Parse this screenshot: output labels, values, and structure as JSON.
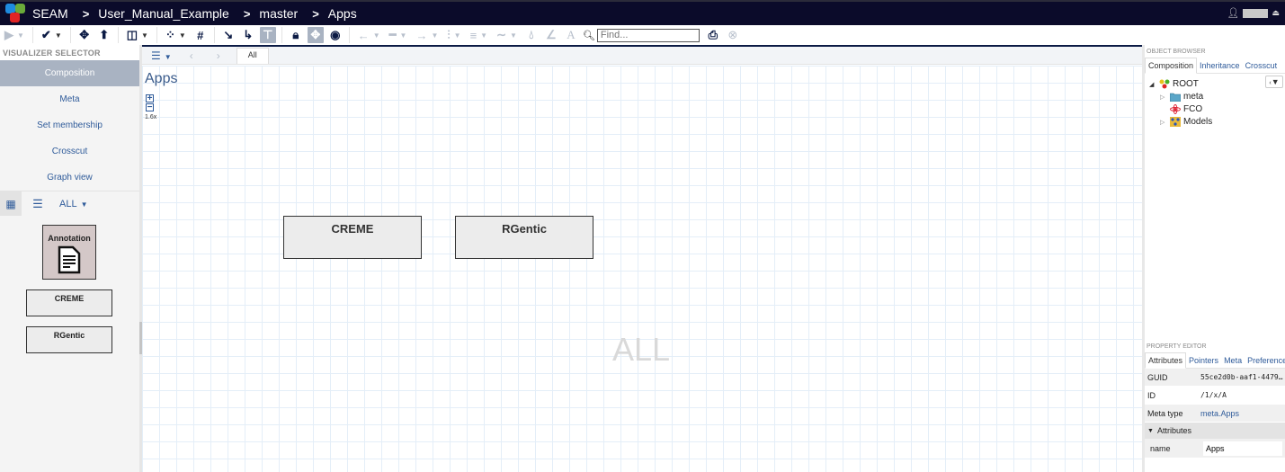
{
  "topbar": {
    "app_name": "SEAM",
    "breadcrumbs": [
      "User_Manual_Example",
      "master",
      "Apps"
    ],
    "separator": ">",
    "user_icon": "user-icon",
    "menu_icon": "eject-icon"
  },
  "toolbar": {
    "buttons": [
      {
        "name": "play-button",
        "glyph": "▶",
        "caret": true,
        "disabled": true
      },
      {
        "name": "check-button",
        "glyph": "✔",
        "caret": true
      },
      {
        "name": "move-button",
        "glyph": "✥"
      },
      {
        "name": "arrow-up-button",
        "glyph": "⬆"
      },
      {
        "name": "columns-button",
        "glyph": "◫",
        "caret": true
      },
      {
        "name": "grid-button",
        "glyph": "⁘",
        "caret": true
      },
      {
        "name": "hash-button",
        "glyph": "#"
      },
      {
        "name": "connect-button",
        "glyph": "↘"
      },
      {
        "name": "elbow-connect-button",
        "glyph": "↳"
      },
      {
        "name": "tree-button",
        "glyph": "⊤",
        "active": true
      },
      {
        "name": "lock-button",
        "glyph": "🔒︎"
      },
      {
        "name": "pan-button",
        "glyph": "✥",
        "active": true
      },
      {
        "name": "eye-button",
        "glyph": "◉"
      },
      {
        "name": "arrow-start-button",
        "glyph": "←",
        "caret": true,
        "disabled": true
      },
      {
        "name": "line-pattern-button",
        "glyph": "━",
        "caret": true,
        "disabled": true
      },
      {
        "name": "arrow-end-button",
        "glyph": "→",
        "caret": true,
        "disabled": true
      },
      {
        "name": "line-type-button",
        "glyph": "⫶",
        "caret": true,
        "disabled": true
      },
      {
        "name": "line-width-button",
        "glyph": "≡",
        "caret": true,
        "disabled": true
      },
      {
        "name": "line-style-button",
        "glyph": "∼",
        "caret": true,
        "disabled": true
      },
      {
        "name": "fill-color-button",
        "glyph": "💧︎",
        "disabled": true
      },
      {
        "name": "border-color-button",
        "glyph": "∠",
        "disabled": true
      },
      {
        "name": "text-color-button",
        "glyph": "A",
        "disabled": true
      }
    ],
    "find_placeholder": "Find...",
    "find_value": "",
    "print_glyph": "⎙",
    "clear_glyph": "⊗"
  },
  "left_panel": {
    "title": "VISUALIZER SELECTOR",
    "visualizers": [
      "Composition",
      "Meta",
      "Set membership",
      "Crosscut",
      "Graph view"
    ],
    "active_visualizer": "Composition",
    "filter_label": "ALL",
    "part_tiles": [
      "Annotation",
      "CREME",
      "RGentic"
    ]
  },
  "main": {
    "tab_label": "All",
    "canvas_title": "Apps",
    "zoom_level": "1.6x",
    "nodes": [
      "CREME",
      "RGentic"
    ],
    "watermark": "ALL"
  },
  "object_browser": {
    "title": "OBJECT BROWSER",
    "tabs": [
      "Composition",
      "Inheritance",
      "Crosscut"
    ],
    "active_tab": "Composition",
    "tree": [
      {
        "label": "ROOT",
        "expanded": true
      },
      {
        "label": "meta",
        "expanded": false
      },
      {
        "label": "FCO"
      },
      {
        "label": "Models",
        "expanded": false
      }
    ]
  },
  "property_editor": {
    "title": "PROPERTY EDITOR",
    "tabs": [
      "Attributes",
      "Pointers",
      "Meta",
      "Preferences"
    ],
    "active_tab": "Attributes",
    "rows": [
      {
        "key": "GUID",
        "value": "55ce2d0b-aaf1-4479…"
      },
      {
        "key": "ID",
        "value": "/1/x/A"
      },
      {
        "key": "Meta type",
        "value": "meta.Apps"
      }
    ],
    "section": "Attributes",
    "attributes": [
      {
        "key": "name",
        "value": "Apps"
      }
    ]
  },
  "colors": {
    "topbar_bg": "#0b0b2a",
    "accent_blue": "#2f5b9a",
    "active_grey": "#a9b3c2",
    "annotation_bg": "#d4c8c8"
  }
}
